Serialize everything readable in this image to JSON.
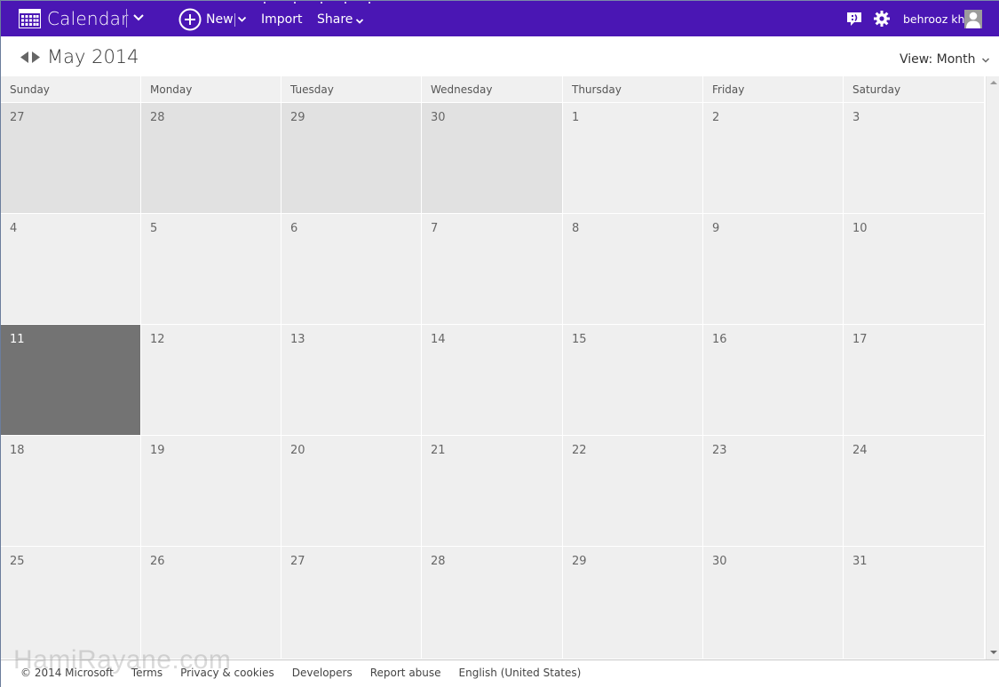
{
  "topbar": {
    "app_title": "Calendar",
    "new_label": "New",
    "import_label": "Import",
    "share_label": "Share",
    "user_name": "behrooz kh",
    "accent_color": "#4a16b4",
    "icons": {
      "app": "calendar-grid-icon",
      "new": "plus-circle-icon",
      "feedback": "smiley-feedback-icon",
      "settings": "gear-icon",
      "avatar": "user-silhouette-icon"
    }
  },
  "header": {
    "month_title": "May 2014",
    "view_label": "View: Month"
  },
  "calendar": {
    "days_of_week": [
      "Sunday",
      "Monday",
      "Tuesday",
      "Wednesday",
      "Thursday",
      "Friday",
      "Saturday"
    ],
    "weeks": [
      [
        {
          "day": "27",
          "state": "other"
        },
        {
          "day": "28",
          "state": "other"
        },
        {
          "day": "29",
          "state": "other"
        },
        {
          "day": "30",
          "state": "other"
        },
        {
          "day": "1",
          "state": "current"
        },
        {
          "day": "2",
          "state": "current"
        },
        {
          "day": "3",
          "state": "current"
        }
      ],
      [
        {
          "day": "4",
          "state": "current"
        },
        {
          "day": "5",
          "state": "current"
        },
        {
          "day": "6",
          "state": "current"
        },
        {
          "day": "7",
          "state": "current"
        },
        {
          "day": "8",
          "state": "current"
        },
        {
          "day": "9",
          "state": "current"
        },
        {
          "day": "10",
          "state": "current"
        }
      ],
      [
        {
          "day": "11",
          "state": "today"
        },
        {
          "day": "12",
          "state": "current"
        },
        {
          "day": "13",
          "state": "current"
        },
        {
          "day": "14",
          "state": "current"
        },
        {
          "day": "15",
          "state": "current"
        },
        {
          "day": "16",
          "state": "current"
        },
        {
          "day": "17",
          "state": "current"
        }
      ],
      [
        {
          "day": "18",
          "state": "current"
        },
        {
          "day": "19",
          "state": "current"
        },
        {
          "day": "20",
          "state": "current"
        },
        {
          "day": "21",
          "state": "current"
        },
        {
          "day": "22",
          "state": "current"
        },
        {
          "day": "23",
          "state": "current"
        },
        {
          "day": "24",
          "state": "current"
        }
      ],
      [
        {
          "day": "25",
          "state": "current"
        },
        {
          "day": "26",
          "state": "current"
        },
        {
          "day": "27",
          "state": "current"
        },
        {
          "day": "28",
          "state": "current"
        },
        {
          "day": "29",
          "state": "current"
        },
        {
          "day": "30",
          "state": "current"
        },
        {
          "day": "31",
          "state": "current"
        }
      ]
    ],
    "colors": {
      "today_bg": "#737373",
      "other_month_bg": "#e1e1e1",
      "current_month_bg": "#efefef"
    }
  },
  "footer": {
    "copyright": "© 2014 Microsoft",
    "links": [
      "Terms",
      "Privacy & cookies",
      "Developers",
      "Report abuse",
      "English (United States)"
    ]
  },
  "watermark": "HamiRayane.com"
}
